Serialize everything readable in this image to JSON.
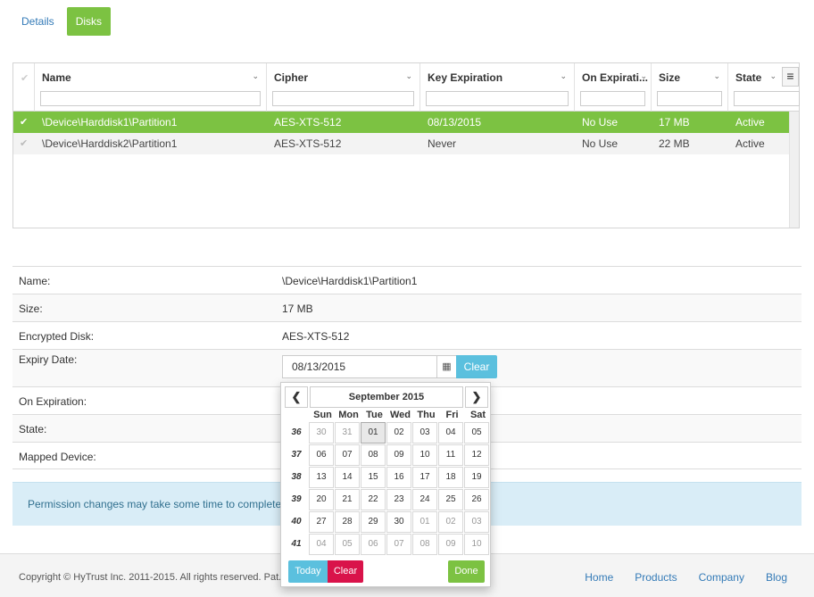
{
  "tabs": [
    {
      "label": "Details",
      "active": false
    },
    {
      "label": "Disks",
      "active": true
    }
  ],
  "grid": {
    "columns": [
      "Name",
      "Cipher",
      "Key Expiration",
      "On Expirati...",
      "Size",
      "State"
    ],
    "rows": [
      {
        "name": "\\Device\\Harddisk1\\Partition1",
        "cipher": "AES-XTS-512",
        "key_expiration": "08/13/2015",
        "on_expiration": "No Use",
        "size": "17 MB",
        "state": "Active",
        "selected": true
      },
      {
        "name": "\\Device\\Harddisk2\\Partition1",
        "cipher": "AES-XTS-512",
        "key_expiration": "Never",
        "on_expiration": "No Use",
        "size": "22 MB",
        "state": "Active",
        "selected": false
      }
    ]
  },
  "details": {
    "name_label": "Name:",
    "name_value": "\\Device\\Harddisk1\\Partition1",
    "size_label": "Size:",
    "size_value": "17 MB",
    "encrypted_label": "Encrypted Disk:",
    "encrypted_value": "AES-XTS-512",
    "expiry_label": "Expiry Date:",
    "expiry_value": "08/13/2015",
    "clear_label": "Clear",
    "on_expiration_label": "On Expiration:",
    "state_label": "State:",
    "mapped_label": "Mapped Device:"
  },
  "info": {
    "text": "Permission changes may take some time to complete and"
  },
  "datepicker": {
    "month_title": "September 2015",
    "dows": [
      "Sun",
      "Mon",
      "Tue",
      "Wed",
      "Thu",
      "Fri",
      "Sat"
    ],
    "weeks": [
      {
        "num": "36",
        "days": [
          "30",
          "31",
          "01",
          "02",
          "03",
          "04",
          "05"
        ]
      },
      {
        "num": "37",
        "days": [
          "06",
          "07",
          "08",
          "09",
          "10",
          "11",
          "12"
        ]
      },
      {
        "num": "38",
        "days": [
          "13",
          "14",
          "15",
          "16",
          "17",
          "18",
          "19"
        ]
      },
      {
        "num": "39",
        "days": [
          "20",
          "21",
          "22",
          "23",
          "24",
          "25",
          "26"
        ]
      },
      {
        "num": "40",
        "days": [
          "27",
          "28",
          "29",
          "30",
          "01",
          "02",
          "03"
        ]
      },
      {
        "num": "41",
        "days": [
          "04",
          "05",
          "06",
          "07",
          "08",
          "09",
          "10"
        ]
      }
    ],
    "today_label": "Today",
    "clear_label": "Clear",
    "done_label": "Done"
  },
  "footer": {
    "copyright": "Copyright © HyTrust Inc. 2011-2015. All rights reserved. Pat.",
    "links": [
      "Home",
      "Products",
      "Company",
      "Blog"
    ]
  },
  "colors": {
    "accent_green": "#7cc242",
    "info_blue": "#5bc0de",
    "danger": "#d9134a"
  }
}
